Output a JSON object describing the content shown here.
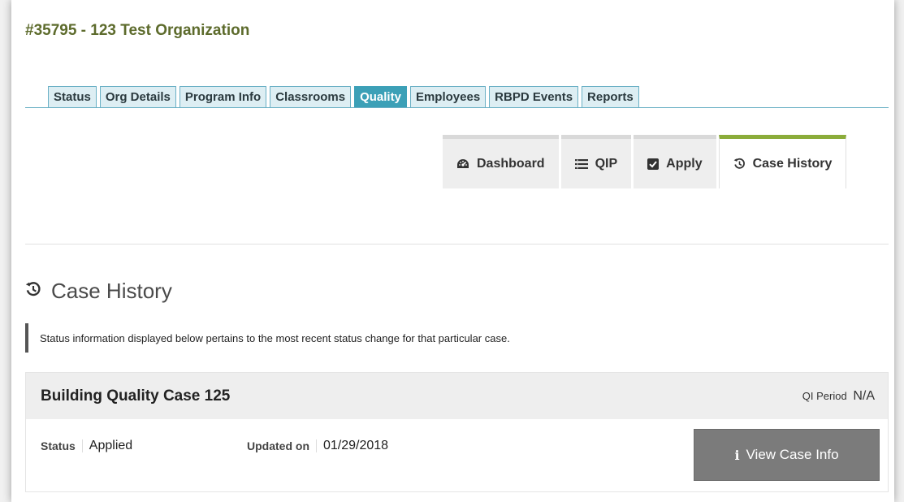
{
  "org": {
    "title": "#35795 - 123 Test Organization"
  },
  "tabs": [
    {
      "label": "Status"
    },
    {
      "label": "Org Details"
    },
    {
      "label": "Program Info"
    },
    {
      "label": "Classrooms"
    },
    {
      "label": "Quality",
      "active": true
    },
    {
      "label": "Employees"
    },
    {
      "label": "RBPD Events"
    },
    {
      "label": "Reports"
    }
  ],
  "subtabs": [
    {
      "label": "Dashboard",
      "icon": "dashboard-icon"
    },
    {
      "label": "QIP",
      "icon": "list-icon"
    },
    {
      "label": "Apply",
      "icon": "checkbox-icon"
    },
    {
      "label": "Case History",
      "icon": "history-icon",
      "active": true
    }
  ],
  "section": {
    "title": "Case History",
    "note": "Status information displayed below pertains to the most recent status change for that particular case."
  },
  "case": {
    "name": "Building Quality Case 125",
    "qi_period_label": "QI Period",
    "qi_period_value": "N/A",
    "status_label": "Status",
    "status_value": "Applied",
    "updated_label": "Updated on",
    "updated_value": "01/29/2018",
    "view_button": "View Case Info"
  },
  "colors": {
    "accent_green": "#8bac3a",
    "tab_active": "#3ca0b7",
    "org_title": "#5d6b2c"
  }
}
